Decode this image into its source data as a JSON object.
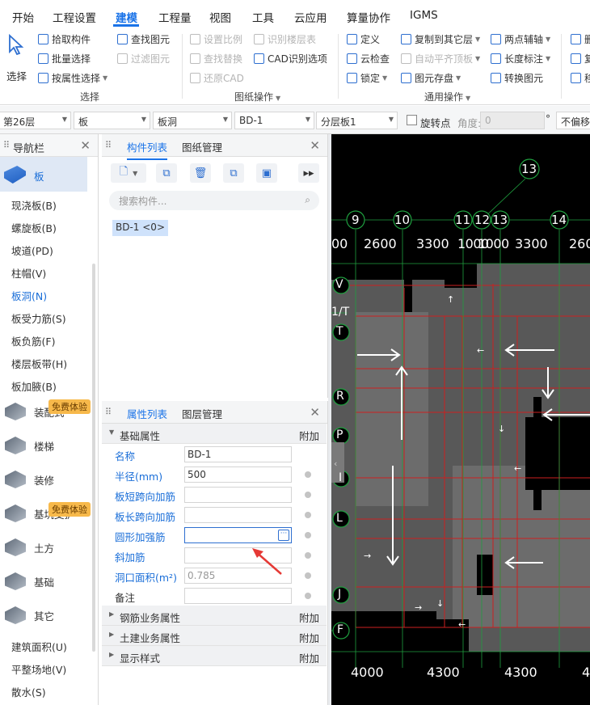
{
  "menu": {
    "items": [
      "开始",
      "工程设置",
      "建模",
      "工程量",
      "视图",
      "工具",
      "云应用",
      "算量协作",
      "IGMS"
    ],
    "active": "建模"
  },
  "ribbon": {
    "select_big": "选择",
    "pick": "拾取构件",
    "batch": "批量选择",
    "by_attr": "按属性选择",
    "find_elem": "查找图元",
    "filter_elem": "过滤图元",
    "set_scale": "设置比例",
    "find_replace": "查找替换",
    "restore_cad": "还原CAD",
    "recog_floor": "识别楼层表",
    "cad_recog": "CAD识别选项",
    "define": "定义",
    "cloud_check": "云检查",
    "lock": "锁定",
    "copy_floor": "复制到其它层",
    "auto_align": "自动平齐顶板",
    "elem_save": "图元存盘",
    "two_point": "两点辅轴",
    "len_dim": "长度标注",
    "convert": "转换图元",
    "del": "删",
    "copy2": "复",
    "move": "移",
    "group_select": "选择",
    "group_drawing": "图纸操作",
    "group_common": "通用操作"
  },
  "propbar": {
    "floor": "第26层",
    "category": "板",
    "type": "板洞",
    "component": "BD-1",
    "layer": "分层板1",
    "rotate_point": "旋转点",
    "angle_label": "角度:",
    "angle_value": "0",
    "degree": "°",
    "offset": "不偏移"
  },
  "nav": {
    "title": "导航栏",
    "active_category": "板",
    "sub_items": [
      "现浇板(B)",
      "螺旋板(B)",
      "坡道(PD)",
      "柱帽(V)",
      "板洞(N)",
      "板受力筋(S)",
      "板负筋(F)",
      "楼层板带(H)",
      "板加腋(B)"
    ],
    "active_sub": "板洞(N)",
    "categories": [
      "装配式",
      "楼梯",
      "装修",
      "基坑支护",
      "土方",
      "基础",
      "其它"
    ],
    "badge": "免费体验",
    "other_items": [
      "建筑面积(U)",
      "平整场地(V)",
      "散水(S)"
    ]
  },
  "component_panel": {
    "tab_list": "构件列表",
    "tab_drawing": "图纸管理",
    "search_placeholder": "搜索构件...",
    "item": "BD-1 <0>"
  },
  "property_panel": {
    "tab_props": "属性列表",
    "tab_layers": "图层管理",
    "col_add": "附加",
    "group_basic": "基础属性",
    "rows": [
      {
        "name": "名称",
        "value": "BD-1"
      },
      {
        "name": "半径(mm)",
        "value": "500"
      },
      {
        "name": "板短跨向加筋",
        "value": ""
      },
      {
        "name": "板长跨向加筋",
        "value": ""
      },
      {
        "name": "圆形加强筋",
        "value": ""
      },
      {
        "name": "斜加筋",
        "value": ""
      },
      {
        "name": "洞口面积(m²)",
        "value": "0.785"
      },
      {
        "name": "备注",
        "value": ""
      }
    ],
    "group_rebar": "钢筋业务属性",
    "group_civil": "土建业务属性",
    "group_display": "显示样式",
    "ellipsis": "···"
  },
  "canvas": {
    "axes_top": [
      "9",
      "10",
      "11",
      "12",
      "13",
      "14"
    ],
    "axis_13_upper": "13",
    "dims_top": [
      "00",
      "2600",
      "3300",
      "1000",
      "1000",
      "3300",
      "260"
    ],
    "axes_left": [
      "V",
      "1/T",
      "T",
      "R",
      "P",
      "I",
      "L",
      "J",
      "F"
    ],
    "dims_bottom": [
      "4000",
      "4300",
      "4300",
      "4"
    ]
  }
}
